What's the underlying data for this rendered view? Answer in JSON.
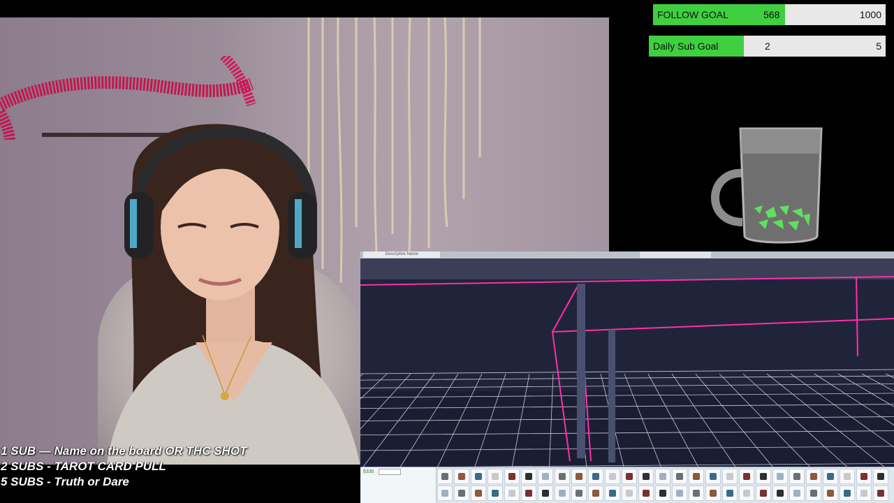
{
  "goals": {
    "follow": {
      "label": "FOLLOW GOAL",
      "current": "568",
      "target": "1000",
      "progress": 0.568
    },
    "daily_sub": {
      "label": "Daily Sub Goal",
      "current": "2",
      "target": "5",
      "progress": 0.4
    }
  },
  "rewards": [
    {
      "text": "1 SUB  —  Name on the board OR THC SHOT"
    },
    {
      "text": "2 SUBS - TAROT CARD PULL"
    },
    {
      "text": "5 SUBS  - Truth or Dare"
    }
  ],
  "game": {
    "window_title": "Descriptive Name",
    "funds": "§335",
    "catalog_count": 54
  },
  "colors": {
    "goal_fill": "#3fcf3f",
    "goal_track": "#e8e8e8",
    "wall_outline": "#ff2fa8",
    "grid_line": "#e7e9f2",
    "mug_gem": "#5fe05f"
  }
}
